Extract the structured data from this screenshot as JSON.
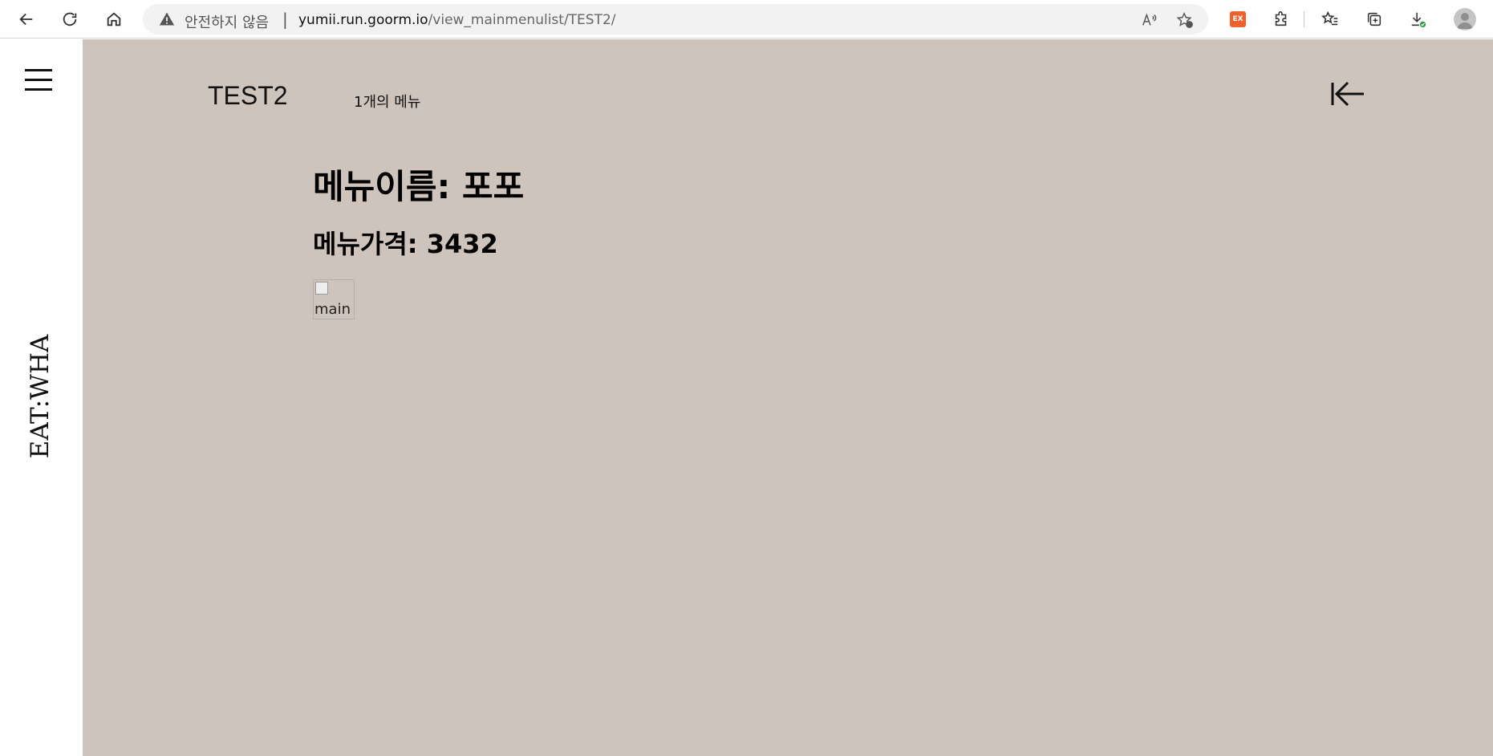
{
  "browser": {
    "insecure_label": "안전하지 않음",
    "separator": "|",
    "url_host": "yumii.run.goorm.io",
    "url_path": "/view_mainmenulist/TEST2/",
    "extension_badge": "EX"
  },
  "sidebar": {
    "brand": "EAT:WHA"
  },
  "main": {
    "store_title": "TEST2",
    "menu_count": "1개의 메뉴",
    "menu_name": "메뉴이름: 포포",
    "menu_price": "메뉴가격: 3432",
    "image_alt": "main"
  },
  "colors": {
    "page_background": "#cfc4bb",
    "sidebar_background": "#ffffff",
    "text": "#000000"
  }
}
